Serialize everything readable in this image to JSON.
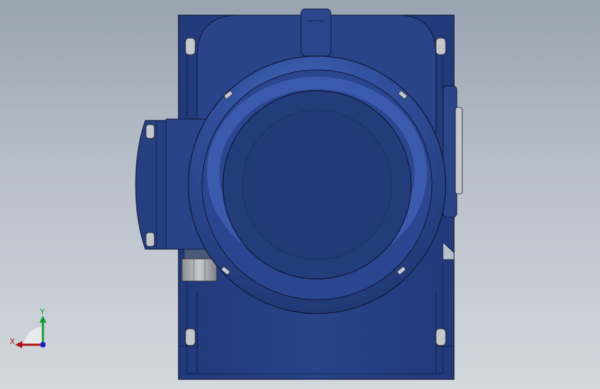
{
  "viewport": {
    "colors": {
      "body": "#263f7f",
      "body_dark": "#1e3368",
      "body_light": "#3a5bb0",
      "outline": "#0d1633",
      "bolt": "#c4c7cc"
    }
  },
  "triad": {
    "x_label": "X",
    "y_label": "Y",
    "x_color": "#b01010",
    "y_color": "#10a030",
    "z_color": "#2020c0"
  }
}
